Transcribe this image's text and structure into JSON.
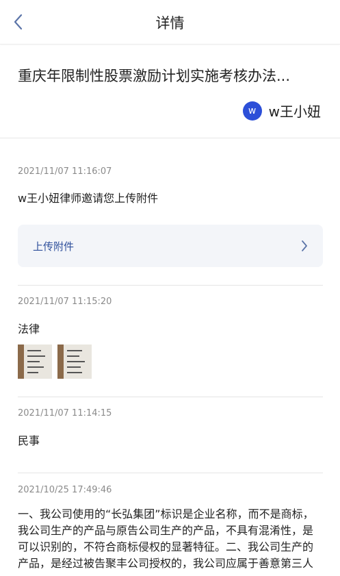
{
  "nav": {
    "title": "详情"
  },
  "header": {
    "case_title": "重庆年限制性股票激励计划实施考核办法...",
    "owner_avatar": "w",
    "owner_name": "w王小妞"
  },
  "entries": [
    {
      "timestamp": "2021/11/07 11:16:07",
      "text": "w王小妞律师邀请您上传附件",
      "action_label": "上传附件"
    },
    {
      "timestamp": "2021/11/07 11:15:20",
      "text": "法律",
      "attachments": [
        "image-1",
        "image-2"
      ]
    },
    {
      "timestamp": "2021/11/07 11:14:15",
      "text": "民事"
    },
    {
      "timestamp": "2021/10/25 17:49:46",
      "lines": [
        "一、我公司使用的“长弘集团”标识是企业名称，而不是商标，",
        "我公司生产的产品与原告公司生产的产品，不具有混淆性，是",
        "可以识别的，不符合商标侵权的显著特征。二、我公司生产的",
        "产品，是经过被告聚丰公司授权的，我公司应属于善意第三人"
      ]
    }
  ],
  "icons": {
    "back": "chevron-left-icon",
    "arrow": "chevron-right-icon"
  },
  "colors": {
    "accent": "#2c4fd8",
    "link": "#2e4f9b",
    "timestamp": "#8a8a8a"
  }
}
